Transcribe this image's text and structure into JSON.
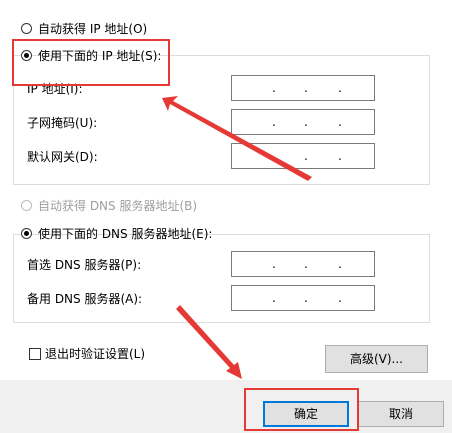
{
  "ip_section": {
    "auto_label": "自动获得 IP 地址(O)",
    "manual_label": "使用下面的 IP 地址(S):",
    "ip_address_label": "IP 地址(I):",
    "subnet_label": "子网掩码(U):",
    "gateway_label": "默认网关(D):",
    "selected": "manual"
  },
  "dns_section": {
    "auto_label": "自动获得 DNS 服务器地址(B)",
    "manual_label": "使用下面的 DNS 服务器地址(E):",
    "preferred_label": "首选 DNS 服务器(P):",
    "alternate_label": "备用 DNS 服务器(A):",
    "selected": "manual"
  },
  "ip_dot": ".",
  "validate_on_exit": {
    "label": "退出时验证设置(L)",
    "checked": false
  },
  "buttons": {
    "advanced": "高级(V)...",
    "ok": "确定",
    "cancel": "取消"
  },
  "colors": {
    "annotation_red": "#e53935",
    "default_button_border": "#0078d7",
    "footer_bg": "#f0f0f0"
  }
}
